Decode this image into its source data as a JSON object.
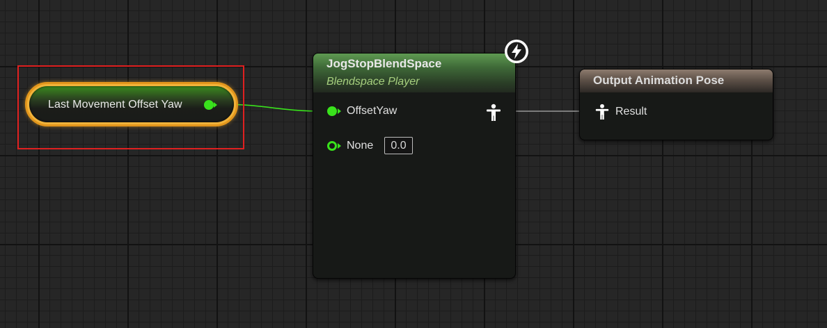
{
  "variable_node": {
    "label": "Last Movement Offset Yaw"
  },
  "blendspace_node": {
    "title": "JogStopBlendSpace",
    "subtitle": "Blendspace Player",
    "pins": [
      {
        "label": "OffsetYaw"
      },
      {
        "label": "None",
        "value": "0.0"
      }
    ],
    "output_icon": "pose-person-icon",
    "badge_icon": "lightning-icon"
  },
  "output_node": {
    "title": "Output Animation Pose",
    "result_label": "Result",
    "input_icon": "pose-person-icon"
  },
  "colors": {
    "float_pin": "#39e21c",
    "selection": "#e02020",
    "variable_border": "#e3961c",
    "blendspace_header": "#5f9a52",
    "output_header": "#8d7b6e"
  }
}
